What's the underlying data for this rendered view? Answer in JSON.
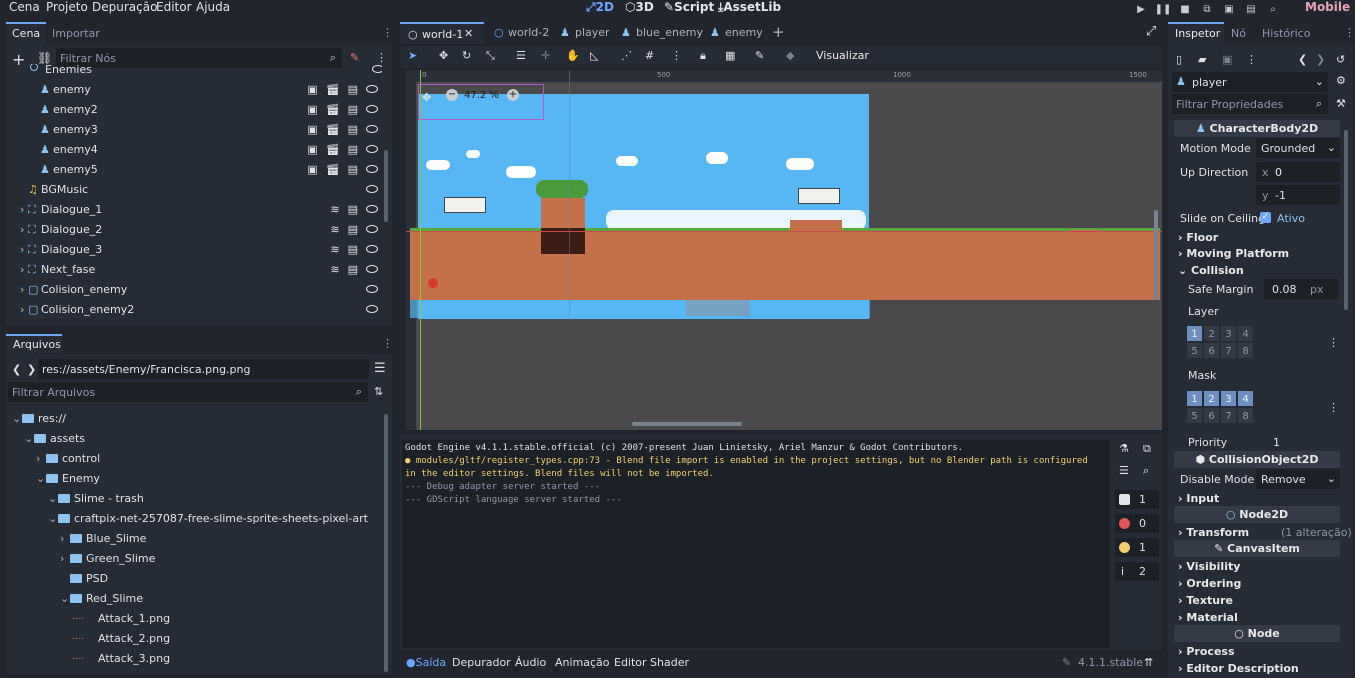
{
  "menu": {
    "items": [
      "Cena",
      "Projeto",
      "Depuração",
      "Editor",
      "Ajuda"
    ]
  },
  "workspaces": [
    {
      "label": "2D",
      "active": true
    },
    {
      "label": "3D",
      "active": false
    },
    {
      "label": "Script",
      "active": false
    },
    {
      "label": "AssetLib",
      "active": false
    }
  ],
  "renderer": "Mobile",
  "left_dock": {
    "tabs": [
      "Cena",
      "Importar"
    ],
    "filter_placeholder": "Filtrar Nós",
    "tree": [
      {
        "label": "Enemies",
        "icon": "node2d-icon"
      },
      {
        "label": "enemy",
        "icon": "character-icon"
      },
      {
        "label": "enemy2",
        "icon": "character-icon"
      },
      {
        "label": "enemy3",
        "icon": "character-icon"
      },
      {
        "label": "enemy4",
        "icon": "character-icon"
      },
      {
        "label": "enemy5",
        "icon": "character-icon"
      },
      {
        "label": "BGMusic",
        "icon": "music-icon"
      },
      {
        "label": "Dialogue_1",
        "icon": "area-icon"
      },
      {
        "label": "Dialogue_2",
        "icon": "area-icon"
      },
      {
        "label": "Dialogue_3",
        "icon": "area-icon"
      },
      {
        "label": "Next_fase",
        "icon": "area-icon"
      },
      {
        "label": "Colision_enemy",
        "icon": "body-icon"
      },
      {
        "label": "Colision_enemy2",
        "icon": "body-icon"
      }
    ]
  },
  "filesystem": {
    "title": "Arquivos",
    "path": "res://assets/Enemy/Francisca.png.png",
    "filter_placeholder": "Filtrar Arquivos",
    "items": [
      "res://",
      "assets",
      "control",
      "Enemy",
      "Slime - trash",
      "craftpix-net-257087-free-slime-sprite-sheets-pixel-art",
      "Blue_Slime",
      "Green_Slime",
      "PSD",
      "Red_Slime",
      "Attack_1.png",
      "Attack_2.png",
      "Attack_3.png"
    ]
  },
  "scene_tabs": [
    "world-1",
    "world-2",
    "player",
    "blue_enemy",
    "enemy"
  ],
  "toolbar": {
    "view_label": "Visualizar"
  },
  "viewport": {
    "zoom": "47.2 %",
    "ruler_labels": [
      "0",
      "500",
      "1000",
      "1500"
    ]
  },
  "console": {
    "lines": [
      "Godot Engine v4.1.1.stable.official (c) 2007-present Juan Linietsky, Ariel Manzur & Godot Contributors.",
      "modules/gltf/register_types.cpp:73 - Blend file import is enabled in the project settings, but no Blender path is configured",
      "in the editor settings. Blend files will not be imported.",
      "--- Debug adapter server started ---",
      "--- GDScript language server started ---"
    ],
    "counts": [
      "1",
      "0",
      "1",
      "2"
    ]
  },
  "bottom_tabs": [
    "Saída",
    "Depurador",
    "Áudio",
    "Animação",
    "Editor Shader"
  ],
  "version": "4.1.1.stable",
  "inspector": {
    "tabs": [
      "Inspetor",
      "Nó",
      "Histórico"
    ],
    "node": "player",
    "filter_placeholder": "Filtrar Propriedades",
    "class_body": "CharacterBody2D",
    "motion_mode_label": "Motion Mode",
    "motion_mode_value": "Grounded",
    "up_direction_label": "Up Direction",
    "up_x": "0",
    "up_y": "-1",
    "slide_label": "Slide on Ceiling",
    "slide_value": "Ativo",
    "floor": "Floor",
    "moving_platform": "Moving Platform",
    "collision": "Collision",
    "safe_margin_label": "Safe Margin",
    "safe_margin_value": "0.08",
    "safe_margin_unit": "px",
    "layer_label": "Layer",
    "mask_label": "Mask",
    "bits": [
      "1",
      "2",
      "3",
      "4",
      "5",
      "6",
      "7",
      "8"
    ],
    "priority_label": "Priority",
    "priority_value": "1",
    "class_collision": "CollisionObject2D",
    "disable_mode_label": "Disable Mode",
    "disable_mode_value": "Remove",
    "input": "Input",
    "class_node2d": "Node2D",
    "transform": "Transform",
    "transform_note": "(1 alteração)",
    "class_canvas": "CanvasItem",
    "visibility": "Visibility",
    "ordering": "Ordering",
    "texture": "Texture",
    "material": "Material",
    "class_node": "Node",
    "process": "Process",
    "editor_description": "Editor Description"
  }
}
